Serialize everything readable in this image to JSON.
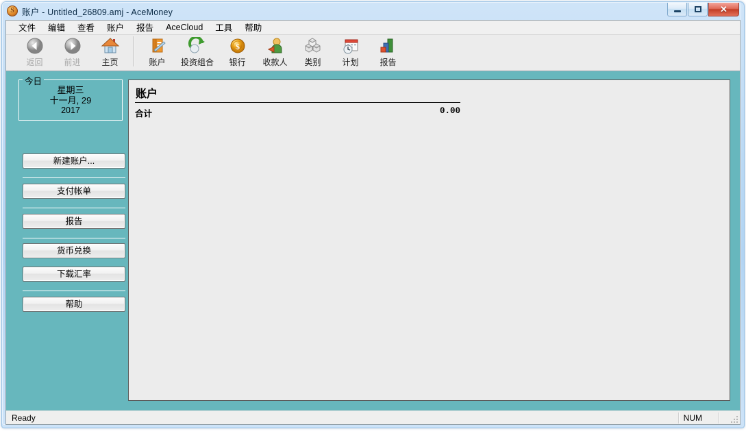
{
  "window": {
    "title": "账户 - Untitled_26809.amj - AceMoney",
    "app_icon": "coin-icon",
    "controls": {
      "minimize": "minimize-icon",
      "maximize": "maximize-icon",
      "close": "✕"
    }
  },
  "menubar": {
    "items": [
      {
        "label": "文件"
      },
      {
        "label": "编辑"
      },
      {
        "label": "查看"
      },
      {
        "label": "账户"
      },
      {
        "label": "报告"
      },
      {
        "label": "AceCloud"
      },
      {
        "label": "工具"
      },
      {
        "label": "帮助"
      }
    ]
  },
  "toolbar": {
    "buttons": [
      {
        "label": "返回",
        "icon": "back-arrow-icon",
        "enabled": false
      },
      {
        "label": "前进",
        "icon": "forward-arrow-icon",
        "enabled": false
      },
      {
        "label": "主页",
        "icon": "home-icon",
        "enabled": true
      },
      {
        "label": "账户",
        "icon": "account-book-icon",
        "enabled": true
      },
      {
        "label": "投资组合",
        "icon": "portfolio-icon",
        "enabled": true
      },
      {
        "label": "银行",
        "icon": "coin-dollar-icon",
        "enabled": true
      },
      {
        "label": "收款人",
        "icon": "payee-person-icon",
        "enabled": true
      },
      {
        "label": "类别",
        "icon": "categories-cubes-icon",
        "enabled": true
      },
      {
        "label": "计划",
        "icon": "schedule-calendar-icon",
        "enabled": true
      },
      {
        "label": "报告",
        "icon": "report-barchart-icon",
        "enabled": true
      }
    ]
  },
  "sidebar": {
    "date_box": {
      "legend": "今日",
      "day_of_week": "星期三",
      "month_day": "十一月, 29",
      "year": "2017"
    },
    "buttons": [
      {
        "label": "新建账户..."
      },
      {
        "label": "支付帐单"
      },
      {
        "label": "报告"
      },
      {
        "label": "货币兑换"
      },
      {
        "label": "下载汇率"
      },
      {
        "label": "帮助"
      }
    ]
  },
  "main": {
    "heading": "账户",
    "total_label": "合计",
    "total_value": "0.00"
  },
  "statusbar": {
    "message": "Ready",
    "num_indicator": "NUM"
  },
  "colors": {
    "teal_background": "#67b7bd",
    "panel_background": "#ececec",
    "titlebar_blue": "#b2d4f3",
    "close_red": "#c33c25"
  }
}
